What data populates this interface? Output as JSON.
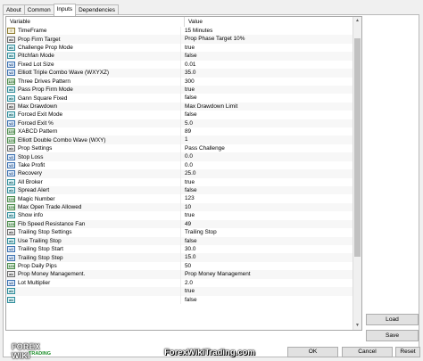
{
  "tabs": [
    "About",
    "Common",
    "Inputs",
    "Dependencies"
  ],
  "active_tab": "Inputs",
  "grid": {
    "header_variable": "Variable",
    "header_value": "Value",
    "rows": [
      {
        "type": "enum",
        "name": "TimeFrame",
        "value": "15 Minutes"
      },
      {
        "type": "str",
        "name": "Prop Firm Target",
        "value": "Prop Phase Target 10%"
      },
      {
        "type": "bool",
        "name": "Challenge Prop Mode",
        "value": "true"
      },
      {
        "type": "bool",
        "name": "Pitchfan Mode",
        "value": "false"
      },
      {
        "type": "dbl",
        "name": "Fixed Lot Size",
        "value": "0.01"
      },
      {
        "type": "dbl",
        "name": "Elliott Triple Combo Wave (WXYXZ)",
        "value": "35.0"
      },
      {
        "type": "int",
        "name": "Three Drives Pattern",
        "value": "300"
      },
      {
        "type": "bool",
        "name": "Pass Prop Firm Mode",
        "value": "true"
      },
      {
        "type": "bool",
        "name": "Gann Square Fixed",
        "value": "false"
      },
      {
        "type": "str",
        "name": "Max Drawdown",
        "value": "Max Drawdown Limit"
      },
      {
        "type": "bool",
        "name": "Forced Exit Mode",
        "value": "false"
      },
      {
        "type": "dbl",
        "name": "Forced Exit %",
        "value": "5.0"
      },
      {
        "type": "int",
        "name": "XABCD Pattern",
        "value": "89"
      },
      {
        "type": "int",
        "name": "Elliott Double Combo Wave (WXY)",
        "value": "1"
      },
      {
        "type": "str",
        "name": "Prop Settings",
        "value": "Pass Challenge"
      },
      {
        "type": "dbl",
        "name": "Stop Loss",
        "value": "0.0"
      },
      {
        "type": "dbl",
        "name": "Take Profit",
        "value": "0.0"
      },
      {
        "type": "dbl",
        "name": "Recovery",
        "value": "25.0"
      },
      {
        "type": "bool",
        "name": "All Broker",
        "value": "true"
      },
      {
        "type": "bool",
        "name": "Spread Alert",
        "value": "false"
      },
      {
        "type": "int",
        "name": "Magic Number",
        "value": "123"
      },
      {
        "type": "int",
        "name": "Max Open Trade Allowed",
        "value": "10"
      },
      {
        "type": "bool",
        "name": "Show info",
        "value": "true"
      },
      {
        "type": "int",
        "name": "Fib Speed Resistance Fan",
        "value": "49"
      },
      {
        "type": "str",
        "name": "Trailing Stop Settings",
        "value": "Trailing Stop"
      },
      {
        "type": "bool",
        "name": "Use Trailing Stop",
        "value": "false"
      },
      {
        "type": "dbl",
        "name": "Trailing Stop Start",
        "value": "30.0"
      },
      {
        "type": "dbl",
        "name": "Trailing Stop Step",
        "value": "15.0"
      },
      {
        "type": "int",
        "name": "Prop Daily Pips",
        "value": "50"
      },
      {
        "type": "str",
        "name": "Prop Money Management.",
        "value": "Prop Money Management"
      },
      {
        "type": "dbl",
        "name": "Lot Multiplier",
        "value": "2.0"
      },
      {
        "type": "bool",
        "name": "",
        "value": "true"
      },
      {
        "type": "bool",
        "name": "",
        "value": "false"
      }
    ]
  },
  "buttons": {
    "load": "Load",
    "save": "Save",
    "ok": "OK",
    "cancel": "Cancel",
    "reset": "Reset"
  },
  "logo": {
    "line1": "FOREX WIKI",
    "line2": "TRADING"
  },
  "watermark": "ForexWikiTrading.com"
}
